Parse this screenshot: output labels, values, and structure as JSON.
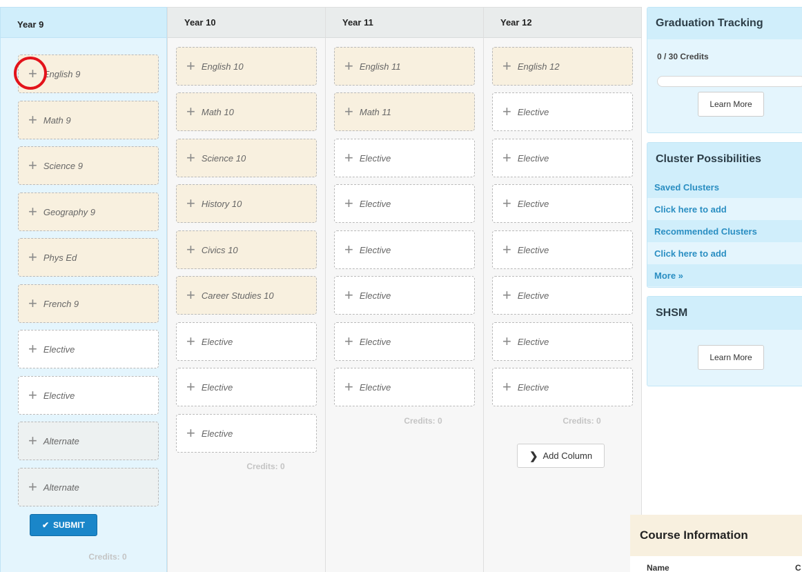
{
  "year9": {
    "title": "Year 9",
    "courses": [
      "English 9",
      "Math 9",
      "Science 9",
      "Geography 9",
      "Phys Ed",
      "French 9",
      "Elective",
      "Elective",
      "Alternate",
      "Alternate"
    ],
    "credits": "Credits: 0"
  },
  "year10": {
    "title": "Year 10",
    "courses": [
      "English 10",
      "Math 10",
      "Science 10",
      "History 10",
      "Civics 10",
      "Career Studies 10",
      "Elective",
      "Elective",
      "Elective"
    ],
    "credits": "Credits: 0"
  },
  "year11": {
    "title": "Year 11",
    "courses": [
      "English 11",
      "Math 11",
      "Elective",
      "Elective",
      "Elective",
      "Elective",
      "Elective",
      "Elective"
    ],
    "credits": "Credits: 0"
  },
  "year12": {
    "title": "Year 12",
    "courses": [
      "English 12",
      "Elective",
      "Elective",
      "Elective",
      "Elective",
      "Elective",
      "Elective",
      "Elective"
    ],
    "credits": "Credits: 0"
  },
  "buttons": {
    "submit": "SUBMIT",
    "add_column": "Add Column"
  },
  "graduation": {
    "title": "Graduation Tracking",
    "credits": "0 / 30 Credits",
    "progress_fraction": 0,
    "learn_more": "Learn More"
  },
  "clusters": {
    "title": "Cluster Possibilities",
    "saved": "Saved Clusters",
    "saved_add": "Click here to add",
    "recommended": "Recommended Clusters",
    "recommended_add": "Click here to add",
    "more": "More »"
  },
  "shsm": {
    "title": "SHSM",
    "learn_more": "Learn More"
  },
  "course_info": {
    "title": "Course Information",
    "col_name": "Name",
    "col_c": "C"
  },
  "colors": {
    "required_card": "#f8f0df",
    "elective_card": "#ffffff",
    "alternate_card": "#edf1f1",
    "active_column": "#e4f5fd",
    "submit_button": "#1a86c9",
    "link": "#2a8ec2",
    "highlight_ring": "#e3131b"
  }
}
